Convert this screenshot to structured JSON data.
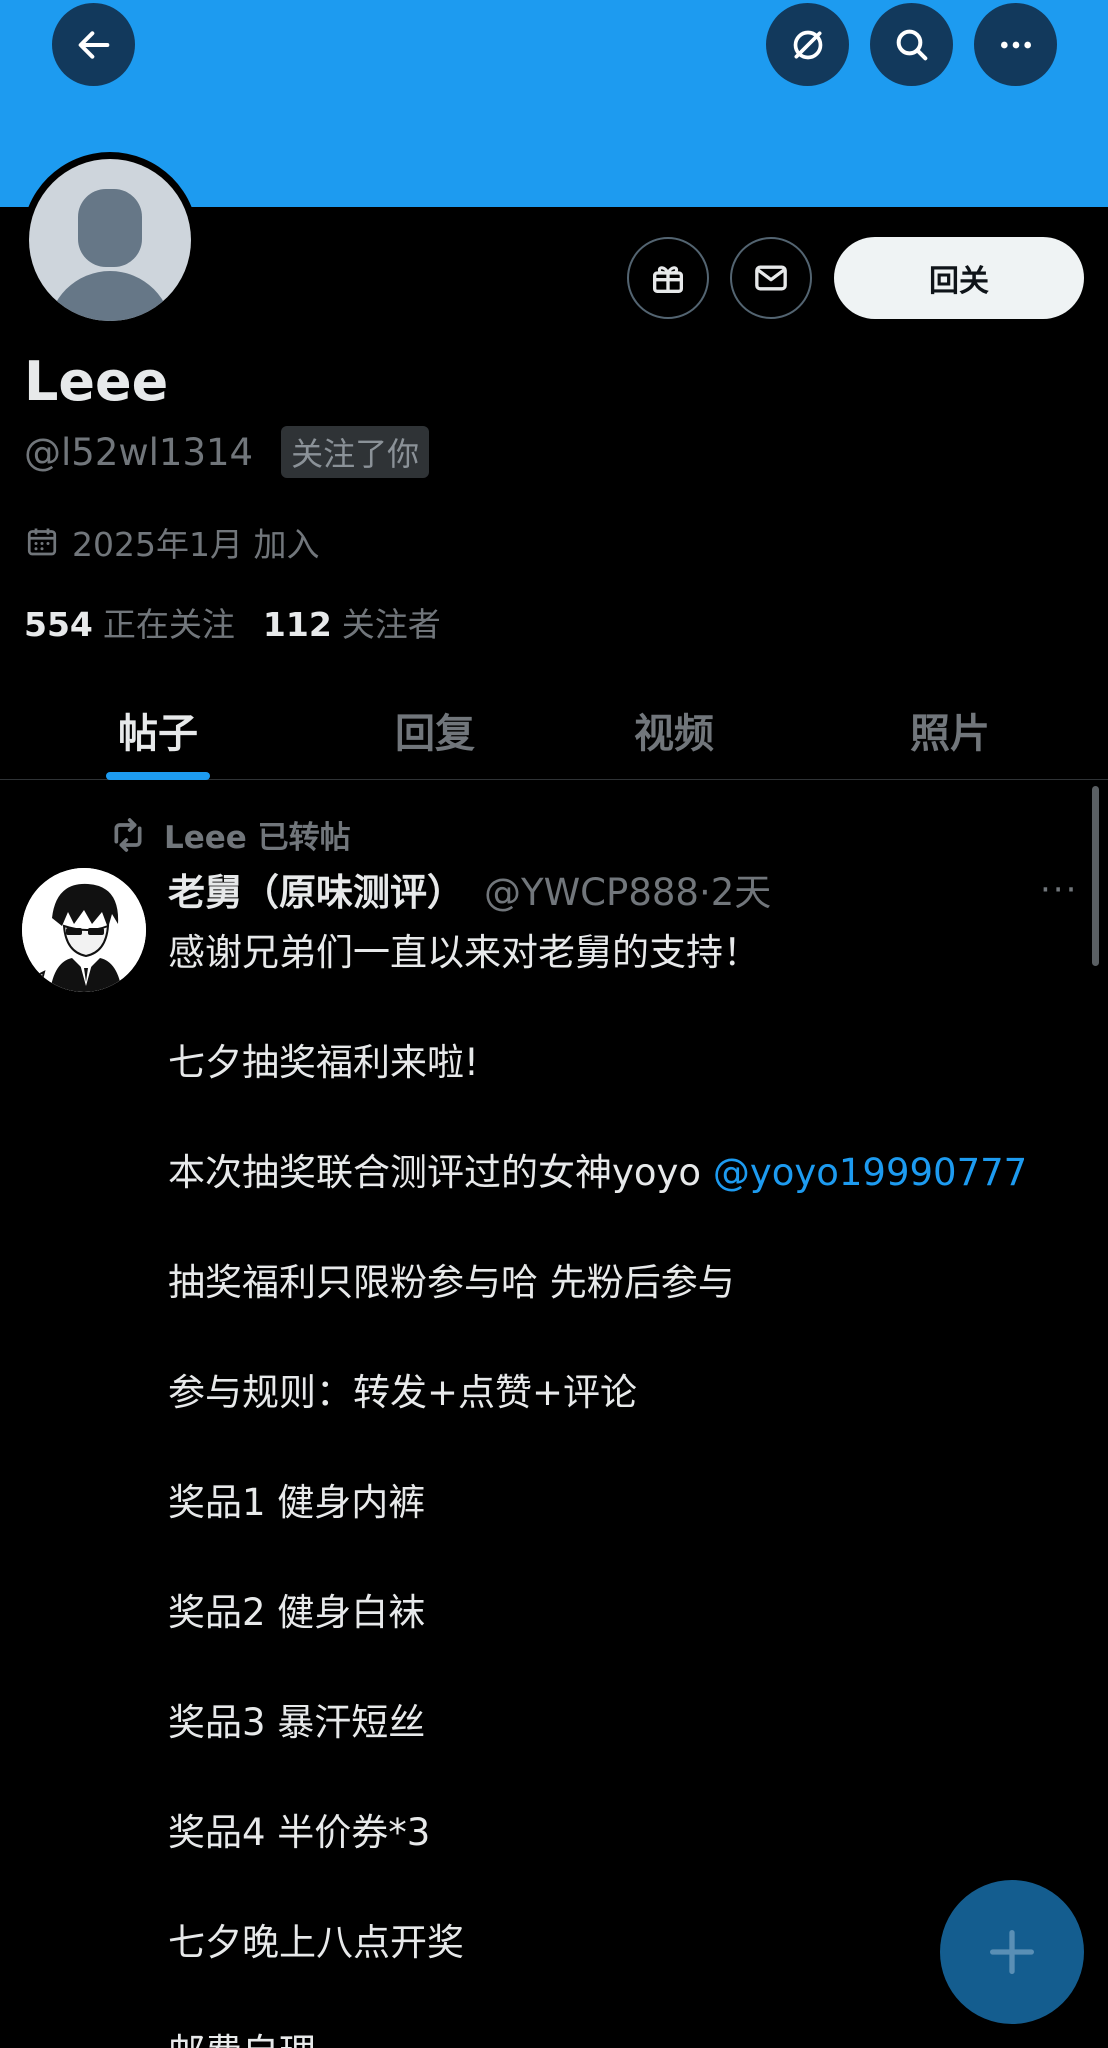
{
  "colors": {
    "banner": "#1d9bf0",
    "accent": "#1d9bf0",
    "background": "#000000",
    "primary_text": "#e7e9ea",
    "secondary_text": "#71767b"
  },
  "top_bar": {
    "icons": [
      "back-arrow-icon",
      "grok-icon",
      "search-icon",
      "more-horizontal-icon"
    ]
  },
  "profile": {
    "display_name": "Leee",
    "handle": "@l52wl1314",
    "follows_you_badge": "关注了你",
    "joined": "2025年1月 加入",
    "following_count": "554",
    "following_label": "正在关注",
    "followers_count": "112",
    "followers_label": "关注者",
    "follow_back_label": "回关",
    "action_icons": [
      "gift-icon",
      "mail-icon"
    ]
  },
  "tabs": [
    {
      "label": "帖子",
      "active": true
    },
    {
      "label": "回复",
      "active": false
    },
    {
      "label": "视频",
      "active": false
    },
    {
      "label": "照片",
      "active": false
    }
  ],
  "post": {
    "repost_text": "Leee 已转帖",
    "author_name": "老舅（原味测评）",
    "author_handle_time": "@YWCP888·2天",
    "more_label": "···",
    "lines": {
      "l1": "感谢兄弟们一直以来对老舅的支持！",
      "l2": "七夕抽奖福利来啦!",
      "l3_text": "本次抽奖联合测评过的女神yoyo ",
      "l3_mention": "@yoyo19990777",
      "l4": "抽奖福利只限粉参与哈 先粉后参与",
      "l5": "参与规则：转发+点赞+评论",
      "l6": "奖品1  健身内裤",
      "l7": "奖品2 健身白袜",
      "l8": "奖品3 暴汗短丝",
      "l9": "奖品4 半价券*3",
      "l10": "七夕晚上八点开奖",
      "l11": "邮费自理"
    }
  },
  "fab": {
    "icon": "plus-icon"
  }
}
